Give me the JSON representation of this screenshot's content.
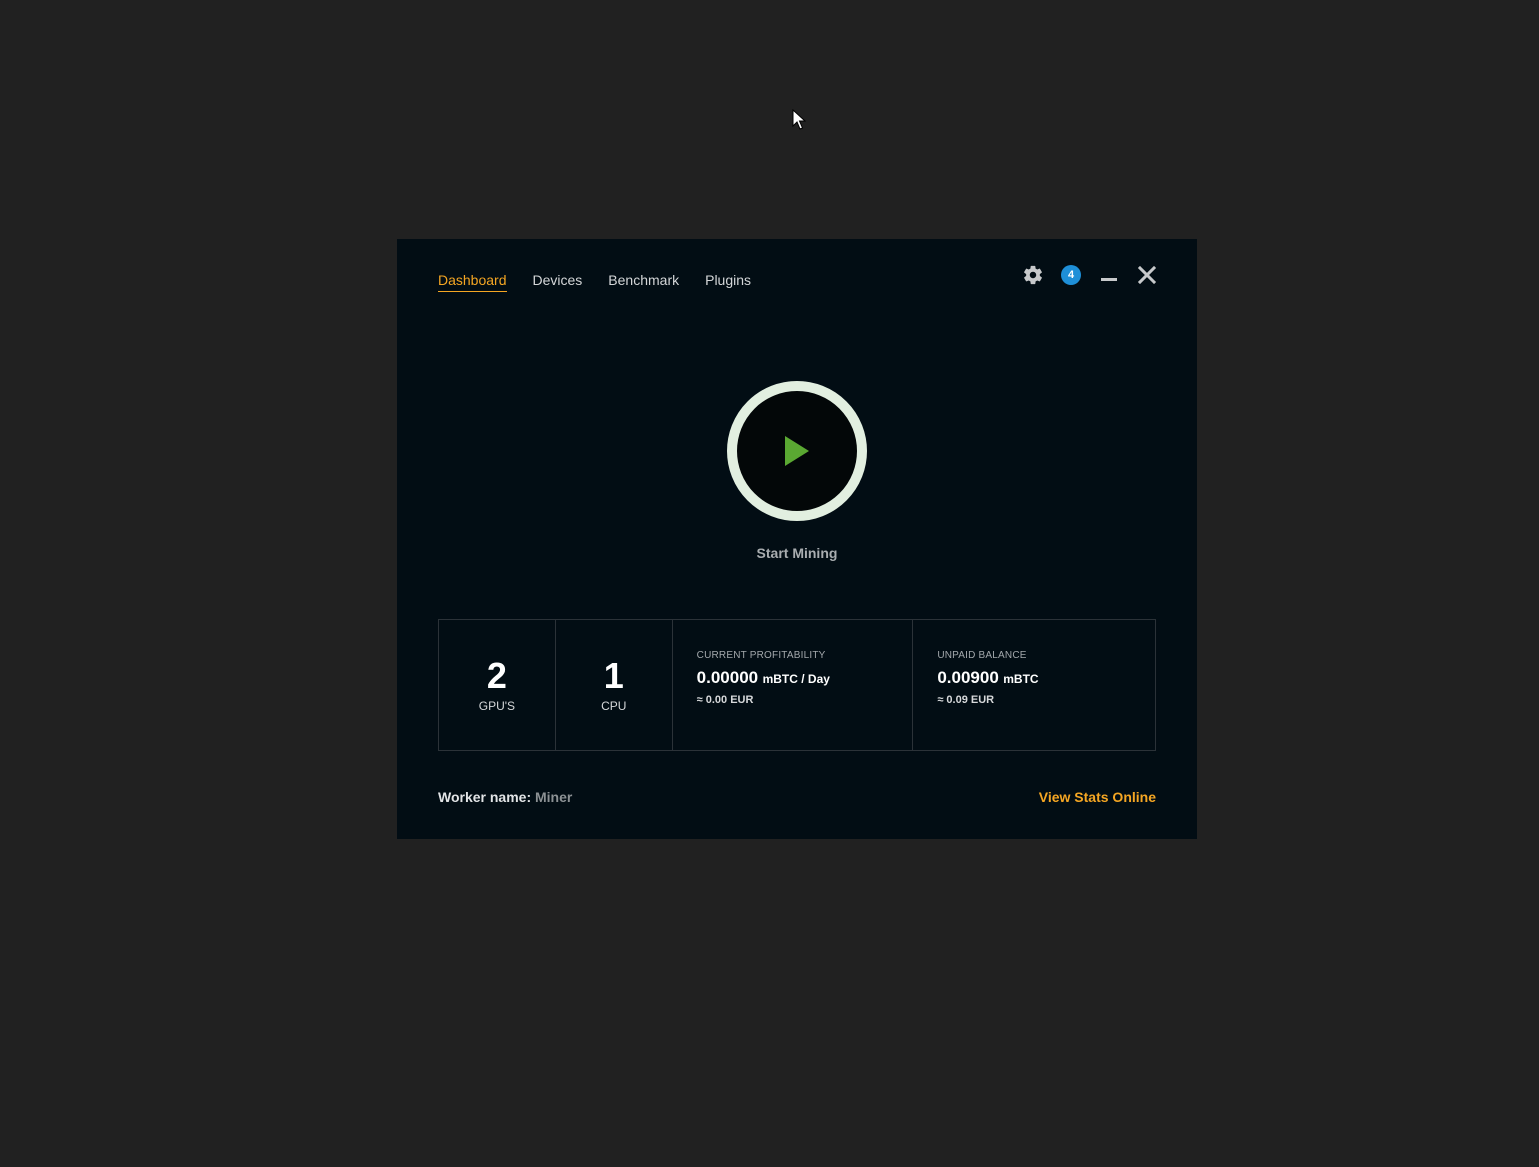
{
  "theme": {
    "accent": "#f5a623",
    "play_green": "#5aa832",
    "ring": "#e2efe0",
    "badge_blue": "#1e8fd8",
    "window_bg": "#020d14",
    "desktop_bg": "#212121"
  },
  "nav": {
    "tabs": [
      {
        "label": "Dashboard",
        "active": true
      },
      {
        "label": "Devices",
        "active": false
      },
      {
        "label": "Benchmark",
        "active": false
      },
      {
        "label": "Plugins",
        "active": false
      }
    ]
  },
  "header": {
    "icons": [
      "gear-icon",
      "minimize-icon",
      "close-icon"
    ],
    "notification_count": "4"
  },
  "start": {
    "label": "Start Mining",
    "icon": "play-icon"
  },
  "stats": {
    "gpus": {
      "value": "2",
      "label": "GPU'S"
    },
    "cpu": {
      "value": "1",
      "label": "CPU"
    },
    "profitability": {
      "title": "CURRENT PROFITABILITY",
      "value": "0.00000",
      "unit": "mBTC / Day",
      "eur": "≈ 0.00 EUR"
    },
    "balance": {
      "title": "UNPAID BALANCE",
      "value": "0.00900",
      "unit": "mBTC",
      "eur": "≈ 0.09 EUR"
    }
  },
  "footer": {
    "worker_label": "Worker name:",
    "worker_value": "Miner",
    "view_stats": "View Stats Online"
  }
}
